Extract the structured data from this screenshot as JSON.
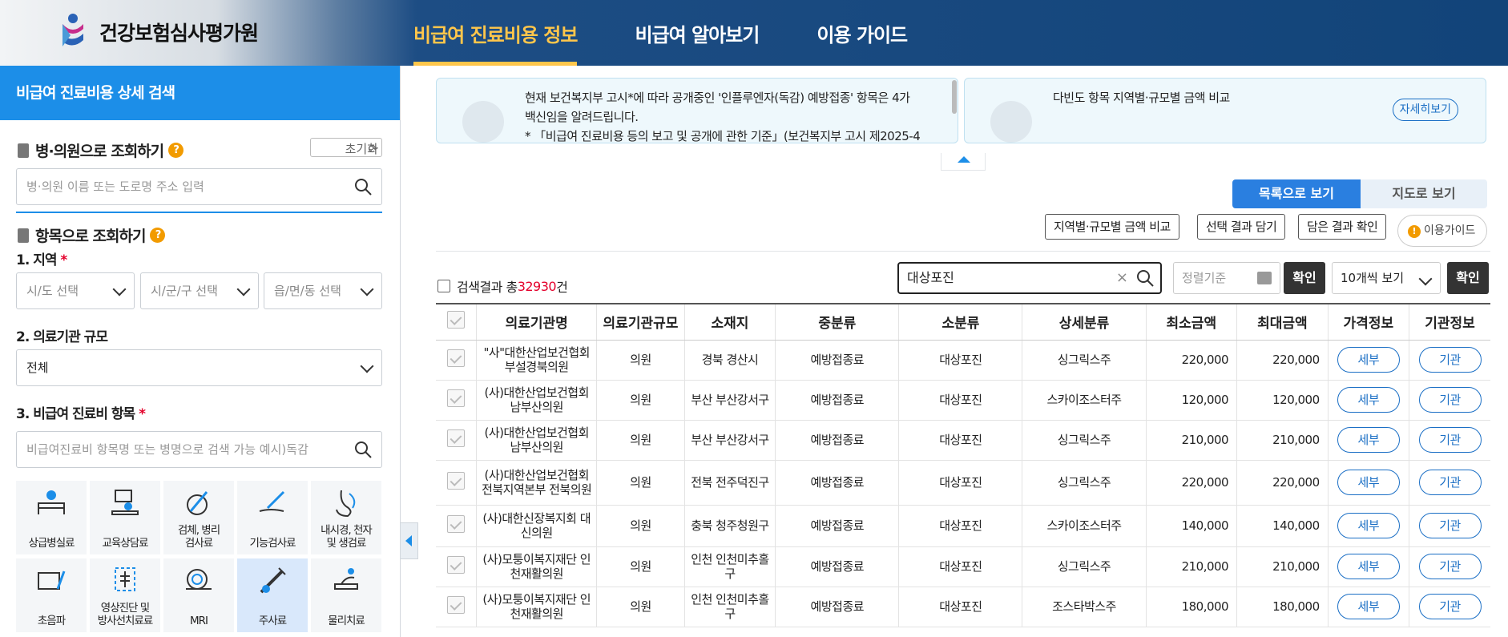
{
  "header": {
    "logo_text": "건강보험심사평가원",
    "nav": [
      {
        "label": "비급여 진료비용 정보"
      },
      {
        "label": "비급여 알아보기"
      },
      {
        "label": "이용 가이드"
      }
    ]
  },
  "sidebar": {
    "title": "비급여 진료비용 상세 검색",
    "hospital_section": "병·의원으로 조회하기",
    "reset_label": "초기화",
    "hospital_placeholder": "병·의원 이름 또는 도로명 주소 입력",
    "item_section": "항목으로 조회하기",
    "region_label": "1. 지역",
    "region_selects": [
      "시/도 선택",
      "시/군/구 선택",
      "읍/면/동 선택"
    ],
    "scale_label": "2. 의료기관 규모",
    "scale_value": "전체",
    "item_label": "3. 비급여 진료비 항목",
    "item_placeholder": "비급여진료비 항목명 또는 병명으로 검색 가능 예시)독감",
    "categories": [
      {
        "line1": "상급병실료",
        "line2": ""
      },
      {
        "line1": "교육상담료",
        "line2": ""
      },
      {
        "line1": "검체, 병리",
        "line2": "검사료"
      },
      {
        "line1": "기능검사료",
        "line2": ""
      },
      {
        "line1": "내시경, 천자",
        "line2": "및 생검료"
      },
      {
        "line1": "초음파",
        "line2": ""
      },
      {
        "line1": "영상진단 및",
        "line2": "방사선치료료"
      },
      {
        "line1": "MRI",
        "line2": ""
      },
      {
        "line1": "주사료",
        "line2": ""
      },
      {
        "line1": "물리치료",
        "line2": ""
      }
    ]
  },
  "notices": [
    {
      "line1": "현재 보건복지부 고시*에 따라 공개중인 '인플루엔자(독감) 예방접종' 항목은 4가",
      "line2": "백신임을 알려드립니다.",
      "line3": "* 「비급여 진료비용 등의 보고 및 공개에 관한 기준」(보건복지부 고시 제2025-4"
    },
    {
      "line1": "다빈도 항목 지역별·규모별 금액 비교",
      "button": "자세히보기"
    }
  ],
  "views": {
    "list": "목록으로 보기",
    "map": "지도로 보기"
  },
  "actions": {
    "compare": "지역별·규모별 금액 비교",
    "save": "선택 결과 담기",
    "check": "담은 결과 확인",
    "guide": "이용가이드"
  },
  "results": {
    "prefix": "검색결과 총",
    "count": "32930",
    "suffix": "건"
  },
  "search": {
    "value": "대상포진",
    "sort_placeholder": "정렬기준",
    "confirm": "확인",
    "per_page": "10개씩 보기"
  },
  "table": {
    "headers": [
      "의료기관명",
      "의료기관규모",
      "소재지",
      "중분류",
      "소분류",
      "상세분류",
      "최소금액",
      "최대금액",
      "가격정보",
      "기관정보"
    ],
    "detail_btn": "세부",
    "org_btn": "기관",
    "rows": [
      {
        "name": "\"사\"대한산업보건협회부설경북의원",
        "scale": "의원",
        "loc": "경북 경산시",
        "mid": "예방접종료",
        "sub": "대상포진",
        "detail": "싱그릭스주",
        "min": "220,000",
        "max": "220,000"
      },
      {
        "name": "(사)대한산업보건협회 남부산의원",
        "scale": "의원",
        "loc": "부산 부산강서구",
        "mid": "예방접종료",
        "sub": "대상포진",
        "detail": "스카이조스터주",
        "min": "120,000",
        "max": "120,000"
      },
      {
        "name": "(사)대한산업보건협회 남부산의원",
        "scale": "의원",
        "loc": "부산 부산강서구",
        "mid": "예방접종료",
        "sub": "대상포진",
        "detail": "싱그릭스주",
        "min": "210,000",
        "max": "210,000"
      },
      {
        "name": "(사)대한산업보건협회 전북지역본부 전북의원",
        "scale": "의원",
        "loc": "전북 전주덕진구",
        "mid": "예방접종료",
        "sub": "대상포진",
        "detail": "싱그릭스주",
        "min": "220,000",
        "max": "220,000"
      },
      {
        "name": "(사)대한신장복지회 대신의원",
        "scale": "의원",
        "loc": "충북 청주청원구",
        "mid": "예방접종료",
        "sub": "대상포진",
        "detail": "스카이조스터주",
        "min": "140,000",
        "max": "140,000"
      },
      {
        "name": "(사)모퉁이복지재단 인천재활의원",
        "scale": "의원",
        "loc": "인천 인천미추홀구",
        "mid": "예방접종료",
        "sub": "대상포진",
        "detail": "싱그릭스주",
        "min": "210,000",
        "max": "210,000"
      },
      {
        "name": "(사)모퉁이복지재단 인천재활의원",
        "scale": "의원",
        "loc": "인천 인천미추홀구",
        "mid": "예방접종료",
        "sub": "대상포진",
        "detail": "조스타박스주",
        "min": "180,000",
        "max": "180,000"
      }
    ]
  },
  "colors": {
    "primary": "#1c8ee8",
    "header_dark": "#124479",
    "nav_active": "#ffc64b",
    "count": "#e4002b"
  }
}
